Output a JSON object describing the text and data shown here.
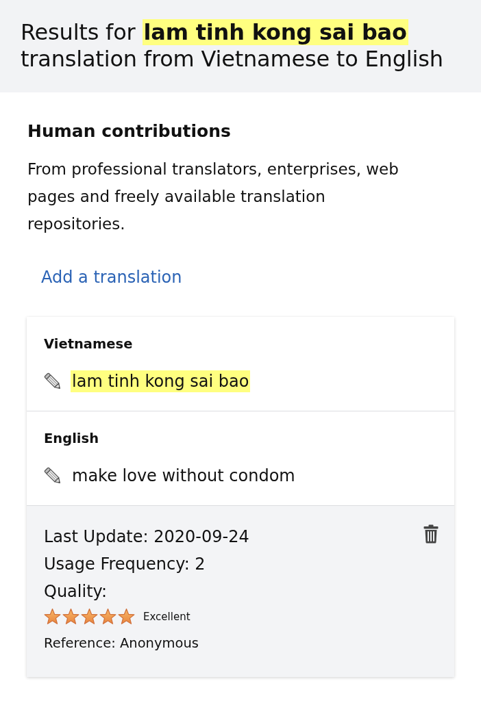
{
  "header": {
    "title": "Results for **lam tinh kong sai bao** translation from Vietnamese to English"
  },
  "contributions": {
    "heading": "Human contributions",
    "description": "From professional translators, enterprises, web pages and freely available translation repositories.",
    "add_link": "Add a translation"
  },
  "entry": {
    "segments": [
      {
        "language": "Vietnamese",
        "text": "lam tinh kong sai bao",
        "highlighted": true
      },
      {
        "language": "English",
        "text": "make love without condom",
        "highlighted": false
      }
    ],
    "last_update": "Last Update: 2020-09-24",
    "usage_frequency": "Usage Frequency: 2",
    "quality_label": "Quality:",
    "stars": 5,
    "quality": "Excellent",
    "reference": "Reference: Anonymous"
  }
}
